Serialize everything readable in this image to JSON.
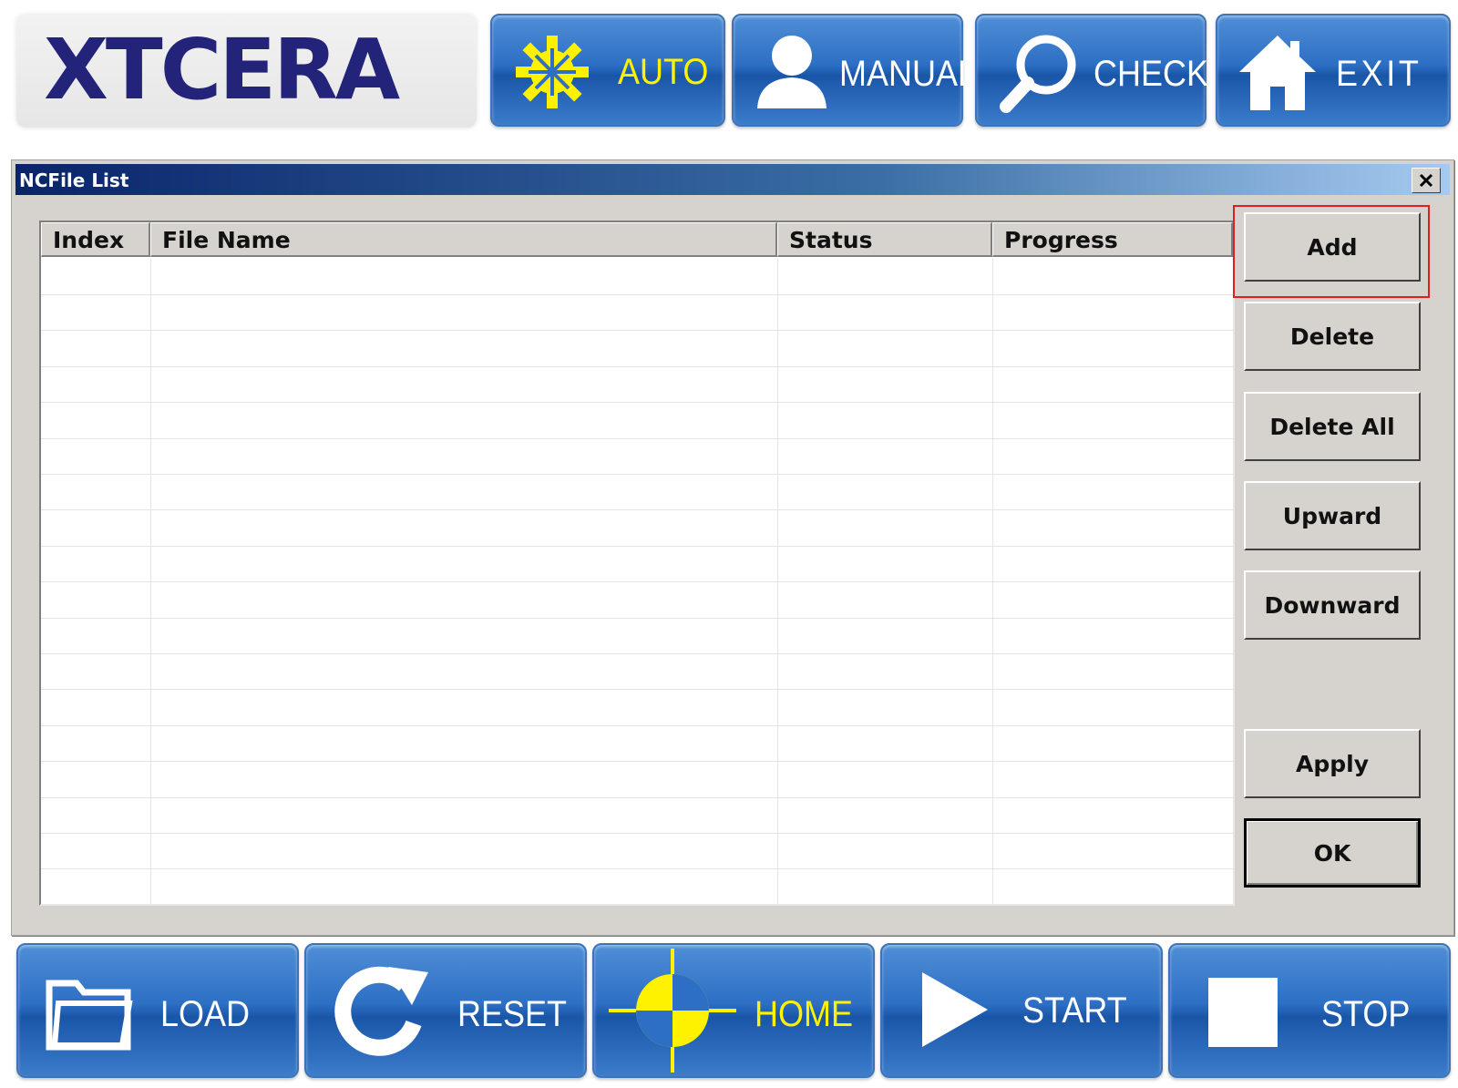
{
  "header": {
    "logo_text": "XTCERA",
    "buttons": [
      {
        "label": "AUTO",
        "icon": "gear-icon"
      },
      {
        "label": "MANUAL",
        "icon": "user-icon"
      },
      {
        "label": "CHECK",
        "icon": "search-icon"
      },
      {
        "label": "EXIT",
        "icon": "home-icon"
      }
    ]
  },
  "dialog": {
    "title": "NCFile List",
    "close_icon": "close-icon",
    "columns": [
      "Index",
      "File Name",
      "Status",
      "Progress"
    ],
    "rows": [],
    "actions": {
      "add": "Add",
      "delete": "Delete",
      "delete_all": "Delete All",
      "upward": "Upward",
      "downward": "Downward",
      "apply": "Apply",
      "ok": "OK"
    },
    "highlighted_action": "add",
    "highlight_color": "#e02020"
  },
  "footer": {
    "buttons": [
      {
        "label": "LOAD",
        "icon": "folder-icon"
      },
      {
        "label": "RESET",
        "icon": "reset-icon"
      },
      {
        "label": "HOME",
        "icon": "crosshair-icon"
      },
      {
        "label": "START",
        "icon": "play-icon"
      },
      {
        "label": "STOP",
        "icon": "stop-icon"
      }
    ]
  },
  "colors": {
    "button_blue": "#2d6fc4",
    "accent_yellow": "#fff200",
    "logo_navy": "#24237a",
    "dialog_gray": "#d6d3ce"
  }
}
